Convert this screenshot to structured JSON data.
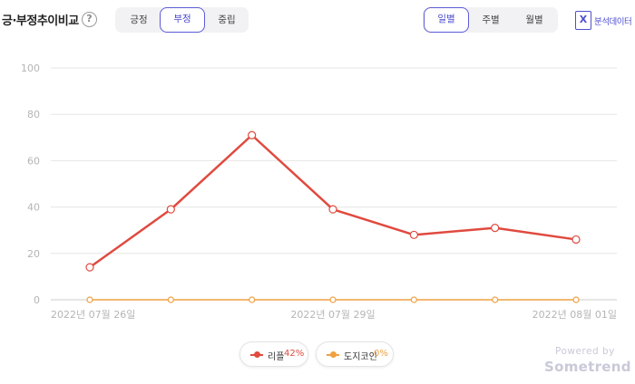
{
  "header": {
    "title": "긍·부정추이비교",
    "help_icon": "?",
    "sentiment_tabs": [
      {
        "label": "긍정",
        "active": false
      },
      {
        "label": "부정",
        "active": true
      },
      {
        "label": "중립",
        "active": false
      }
    ],
    "period_tabs": [
      {
        "label": "일별",
        "active": true
      },
      {
        "label": "주별",
        "active": false
      },
      {
        "label": "월별",
        "active": false
      }
    ],
    "excel_icon": "X",
    "excel_label": "분석데이터"
  },
  "colors": {
    "accent": "#5b5bd6",
    "series1": "#e04a3f",
    "series2": "#f0a040",
    "grid": "#e6e6e6",
    "axis_text": "#b5b5b5"
  },
  "chart_data": {
    "type": "line",
    "y_ticks": [
      "100",
      "80",
      "60",
      "40",
      "20",
      "0"
    ],
    "x_tick_labels": [
      "2022년 07월 26일",
      "2022년 07월 29일",
      "2022년 08월 01일"
    ],
    "x_tick_indices": [
      0,
      3,
      6
    ],
    "ylim": [
      0,
      100
    ],
    "grid": true,
    "legend_position": "bottom-center",
    "series": [
      {
        "name": "리플",
        "share": "42%",
        "color": "#e04a3f",
        "values": [
          14,
          39,
          71,
          39,
          28,
          31,
          26
        ]
      },
      {
        "name": "도지코인",
        "share": "0%",
        "color": "#f0a040",
        "values": [
          0,
          0,
          0,
          0,
          0,
          0,
          0
        ]
      }
    ]
  },
  "footer": {
    "powered_by": "Powered by",
    "brand": "Sometrend"
  }
}
